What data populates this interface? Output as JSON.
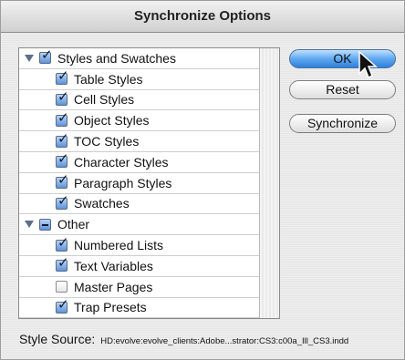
{
  "window": {
    "title": "Synchronize Options"
  },
  "list": {
    "items": [
      {
        "label": "Styles and Swatches",
        "level": 0,
        "state": "checked",
        "expanded": true
      },
      {
        "label": "Table Styles",
        "level": 1,
        "state": "checked"
      },
      {
        "label": "Cell Styles",
        "level": 1,
        "state": "checked"
      },
      {
        "label": "Object Styles",
        "level": 1,
        "state": "checked"
      },
      {
        "label": "TOC Styles",
        "level": 1,
        "state": "checked"
      },
      {
        "label": "Character Styles",
        "level": 1,
        "state": "checked"
      },
      {
        "label": "Paragraph Styles",
        "level": 1,
        "state": "checked"
      },
      {
        "label": "Swatches",
        "level": 1,
        "state": "checked"
      },
      {
        "label": "Other",
        "level": 0,
        "state": "mixed",
        "expanded": true
      },
      {
        "label": "Numbered Lists",
        "level": 1,
        "state": "checked"
      },
      {
        "label": "Text Variables",
        "level": 1,
        "state": "checked"
      },
      {
        "label": "Master Pages",
        "level": 1,
        "state": "unchecked"
      },
      {
        "label": "Trap Presets",
        "level": 1,
        "state": "checked"
      }
    ]
  },
  "buttons": {
    "ok": "OK",
    "reset": "Reset",
    "synchronize": "Synchronize"
  },
  "style_source": {
    "label": "Style Source:",
    "path": "HD:evolve:evolve_clients:Adobe...strator:CS3:c00a_Ill_CS3.indd"
  },
  "colors": {
    "accent": "#3f8be0",
    "checkbox": "#5d93dc"
  }
}
